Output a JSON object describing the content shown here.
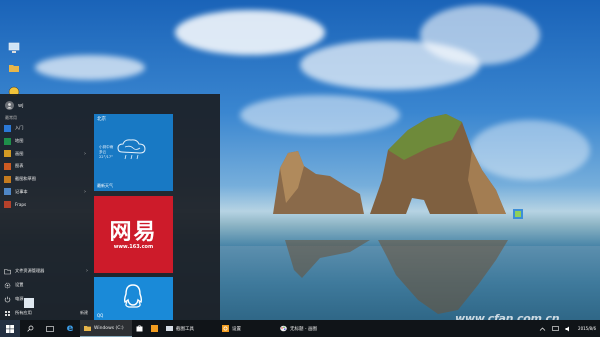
{
  "desktop": {
    "icons": [
      {
        "label": "",
        "icon": "computer-icon"
      },
      {
        "label": "",
        "icon": "folder-icon"
      },
      {
        "label": "",
        "icon": "network-icon"
      }
    ]
  },
  "start_menu": {
    "user": {
      "name": "wj"
    },
    "section_label": "最常用",
    "apps": [
      {
        "label": "入门",
        "icon": "lightbulb-icon",
        "color": "#2b78d6",
        "has_arrow": false
      },
      {
        "label": "地图",
        "icon": "maps-icon",
        "color": "#1e8f4a",
        "has_arrow": false
      },
      {
        "label": "画图",
        "icon": "paint-icon",
        "color": "#d29a24",
        "has_arrow": true
      },
      {
        "label": "图表",
        "icon": "chart-icon",
        "color": "#cc5a22",
        "has_arrow": false
      },
      {
        "label": "截图和草图",
        "icon": "snip-icon",
        "color": "#c47b1f",
        "has_arrow": false
      },
      {
        "label": "记事本",
        "icon": "notepad-icon",
        "color": "#4f87c7",
        "has_arrow": true
      },
      {
        "label": "Fraps",
        "icon": "fraps-icon",
        "color": "#b5412b",
        "has_arrow": false
      }
    ],
    "bottom": [
      {
        "label": "文件资源管理器",
        "icon": "folder-icon",
        "has_arrow": true
      },
      {
        "label": "设置",
        "icon": "gear-icon",
        "has_arrow": false
      },
      {
        "label": "电源",
        "icon": "power-icon",
        "has_arrow": false
      },
      {
        "label": "所有应用",
        "icon": "apps-icon",
        "new_label": "新建"
      }
    ],
    "tiles": {
      "weather": {
        "city": "北京",
        "line1": "小到中雨",
        "line2": "多云",
        "line3": "22°/17°",
        "footer": "最新天气"
      },
      "netease": {
        "logo_text": "网易",
        "url": "www.163.com"
      },
      "qq": {
        "label": "QQ"
      }
    }
  },
  "taskbar": {
    "apps": [
      {
        "label": "Windows (C:)",
        "icon": "folder-icon",
        "active": true
      },
      {
        "label": "",
        "icon": "store-icon",
        "active": false
      },
      {
        "label": "",
        "icon": "image-icon",
        "active": false
      },
      {
        "label": "截图工具",
        "icon": "snip-icon",
        "active": false
      },
      {
        "label": "设置",
        "icon": "gear-icon",
        "active": false
      },
      {
        "label": "无标题 - 画图",
        "icon": "paint-icon",
        "active": false
      }
    ],
    "clock": {
      "time": "",
      "date": "2015/8/6"
    }
  },
  "watermark": "www.cfan.com.cn",
  "colors": {
    "accent": "#1879c4",
    "netease_red": "#cd1b2a",
    "taskbar": "#101418"
  }
}
